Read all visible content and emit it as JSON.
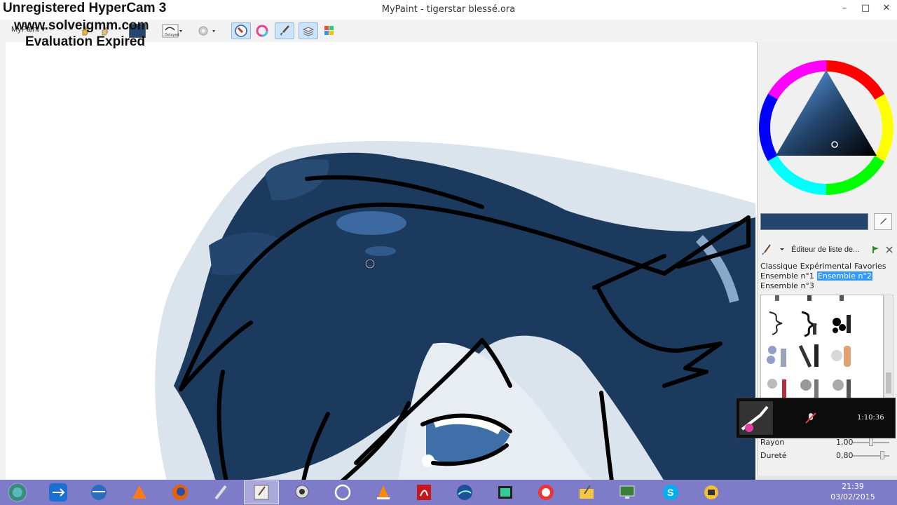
{
  "watermark": {
    "line1": "Unregistered HyperCam 3",
    "line2": "www.solveigmm.com",
    "line3": "Evaluation Expired"
  },
  "window": {
    "title": "MyPaint - tigerstar blessé.ora",
    "controls": {
      "minimize": "–",
      "maximize": "□",
      "close": "✕"
    }
  },
  "toolbar": {
    "menu_label": "MyPaint",
    "items": [
      {
        "icon": "hand-icon"
      },
      {
        "icon": "hand-rotate-icon"
      },
      {
        "icon": "color-swatch-icon",
        "color": "#24466e"
      },
      {
        "icon": "delayed-stroke-icon"
      },
      {
        "icon": "settings-gear-icon"
      },
      {
        "icon": "brush-history-icon"
      },
      {
        "icon": "color-ring-icon"
      },
      {
        "icon": "brush-icon"
      },
      {
        "icon": "layers-icon"
      },
      {
        "icon": "palette-icon"
      }
    ]
  },
  "color_panel": {
    "current_color": "#24466e",
    "picker_icon": "eyedropper-icon"
  },
  "brush_editor": {
    "title": "Éditeur de liste de...",
    "groups": [
      "Classique",
      "Expérimental",
      "Favories",
      "Ensemble n°1",
      "Ensemble n°2",
      "Ensemble n°3"
    ],
    "selected_group": "Ensemble n°2"
  },
  "brush_params": [
    {
      "name": "Rayon",
      "value": "1,00",
      "level": 0.5
    },
    {
      "name": "Dureté",
      "value": "0,80",
      "level": 0.8
    }
  ],
  "recorder_overlay": {
    "time": "1:10:36"
  },
  "taskbar": {
    "apps": [
      {
        "icon": "start-orb-icon"
      },
      {
        "icon": "teamviewer-icon"
      },
      {
        "icon": "thunderbird-icon"
      },
      {
        "icon": "avast-icon"
      },
      {
        "icon": "firefox-icon"
      },
      {
        "icon": "pen-tablet-icon"
      },
      {
        "icon": "mypaint-icon",
        "active": true
      },
      {
        "icon": "webcam-icon"
      },
      {
        "icon": "sync-icon"
      },
      {
        "icon": "vlc-icon"
      },
      {
        "icon": "acrobat-icon"
      },
      {
        "icon": "google-earth-icon"
      },
      {
        "icon": "film-icon"
      },
      {
        "icon": "record-icon"
      },
      {
        "icon": "paint-folder-icon"
      },
      {
        "icon": "remote-desktop-icon"
      },
      {
        "icon": "skype-icon"
      },
      {
        "icon": "audio-icon"
      }
    ],
    "time": "21:39",
    "date": "03/02/2015"
  }
}
